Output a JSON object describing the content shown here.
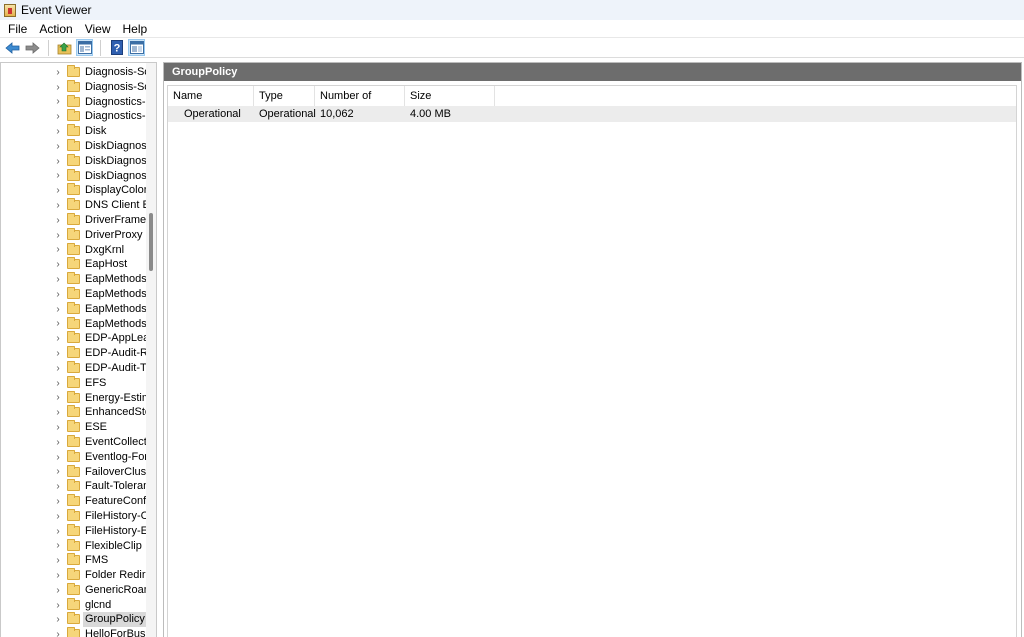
{
  "window": {
    "title": "Event Viewer"
  },
  "menu": [
    "File",
    "Action",
    "View",
    "Help"
  ],
  "toolbar": {
    "buttons": [
      "back-arrow-icon",
      "forward-arrow-icon",
      "up-folder-icon",
      "show-hide-tree-icon",
      "help-icon",
      "show-hide-action-pane-icon"
    ]
  },
  "tree": {
    "items": [
      "Diagnosis-Scrip",
      "Diagnosis-Scrip",
      "Diagnostics-Ne",
      "Diagnostics-Pe",
      "Disk",
      "DiskDiagnostic",
      "DiskDiagnostic",
      "DiskDiagnostic",
      "DisplayColorCa",
      "DNS Client Eve",
      "DriverFramewo",
      "DriverProxy",
      "DxgKrnl",
      "EapHost",
      "EapMethods-R",
      "EapMethods-R",
      "EapMethods-S",
      "EapMethods-T",
      "EDP-AppLearni",
      "EDP-Audit-Reg",
      "EDP-Audit-TCB",
      "EFS",
      "Energy-Estima",
      "EnhancedStora",
      "ESE",
      "EventCollector",
      "Eventlog-Forw",
      "FailoverCluster",
      "Fault-Tolerant-",
      "FeatureConfigu",
      "FileHistory-Cor",
      "FileHistory-Eng",
      "FlexibleClip",
      "FMS",
      "Folder Redirect",
      "GenericRoamin",
      "glcnd",
      "GroupPolicy",
      "HelloForBusine"
    ],
    "selected_index": 37
  },
  "panel": {
    "title": "GroupPolicy",
    "columns": [
      "Name",
      "Type",
      "Number of Events",
      "Size"
    ],
    "rows": [
      [
        "Operational",
        "Operational",
        "10,062",
        "4.00 MB"
      ]
    ]
  }
}
